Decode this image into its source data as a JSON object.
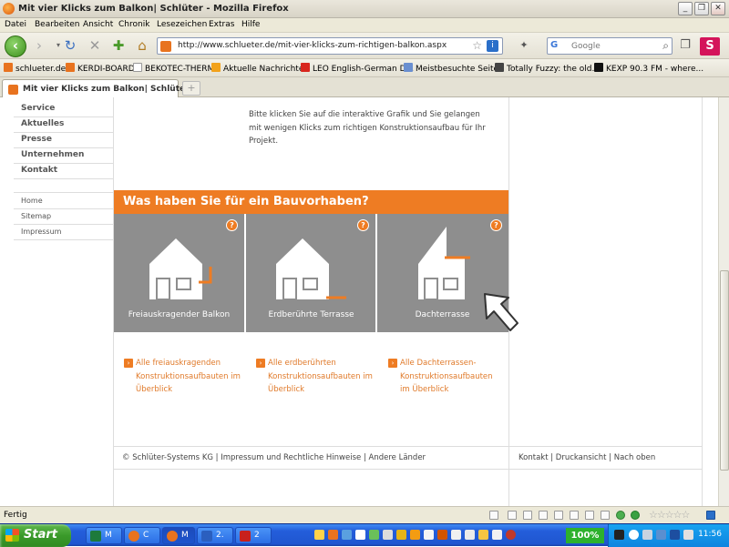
{
  "window": {
    "title": "Mit vier Klicks zum Balkon| Schlüter - Mozilla Firefox"
  },
  "menu": [
    "Datei",
    "Bearbeiten",
    "Ansicht",
    "Chronik",
    "Lesezeichen",
    "Extras",
    "Hilfe"
  ],
  "nav": {
    "url": "http://www.schlueter.de/mit-vier-klicks-zum-richtigen-balkon.aspx",
    "search_placeholder": "Google",
    "search_engine": "G"
  },
  "bookmarks": [
    "schlueter.de",
    "KERDI-BOARD",
    "BEKOTEC-THERM",
    "Aktuelle Nachrichten",
    "LEO English-German D...",
    "Meistbesuchte Seiten",
    "Totally Fuzzy: the old...",
    "KEXP 90.3 FM - where..."
  ],
  "tab": {
    "title": "Mit vier Klicks zum Balkon| Schlüter",
    "new_tab": "+"
  },
  "sidebar": {
    "main": [
      "Service",
      "Aktuelles",
      "Presse",
      "Unternehmen",
      "Kontakt"
    ],
    "secondary": [
      "Home",
      "Sitemap",
      "Impressum"
    ]
  },
  "page": {
    "intro": "Bitte klicken Sie auf die interaktive Grafik und Sie gelangen mit wenigen Klicks zum richtigen Konstruktionsaufbau für Ihr Projekt.",
    "banner": "Was haben Sie für ein Bauvorhaben?",
    "help_glyph": "?",
    "options": [
      {
        "label": "Freiauskragender Balkon",
        "link": "Alle freiauskragenden Konstruktionsaufbauten im Überblick"
      },
      {
        "label": "Erdberührte Terrasse",
        "link": "Alle erdberührten Konstruktionsaufbauten im Überblick"
      },
      {
        "label": "Dachterrasse",
        "link": "Alle Dachterrassen-Konstruktionsaufbauten im Überblick"
      }
    ],
    "footer_left": "© Schlüter-Systems KG | Impressum und Rechtliche Hinweise | Andere Länder",
    "footer_right": "Kontakt | Druckansicht | Nach oben"
  },
  "status": {
    "text": "Fertig"
  },
  "taskbar": {
    "start": "Start",
    "tasks": [
      "M",
      "C",
      "M",
      "2.",
      "2"
    ],
    "battery": "100%",
    "clock": "11:56"
  },
  "colors": {
    "accent": "#ee7c23",
    "panel": "#8e8e8e"
  },
  "icons": [
    "firefox-icon",
    "back-icon",
    "forward-icon",
    "reload-icon",
    "stop-icon",
    "home-icon",
    "bookmark-star-icon",
    "search-icon",
    "help-icon",
    "arrow-cursor-icon"
  ]
}
